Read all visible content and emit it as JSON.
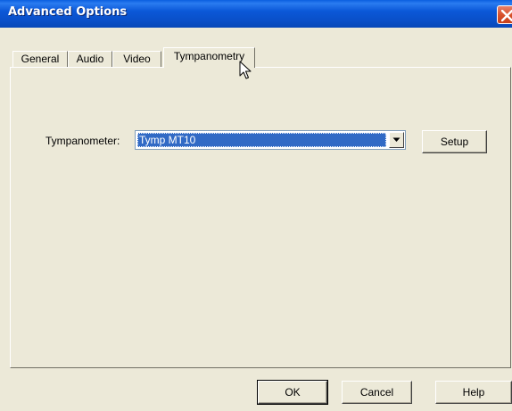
{
  "window": {
    "title": "Advanced Options"
  },
  "tabs": [
    {
      "label": "General",
      "active": false
    },
    {
      "label": "Audio",
      "active": false
    },
    {
      "label": "Video",
      "active": false
    },
    {
      "label": "Tympanometry",
      "active": true
    }
  ],
  "tympanometry": {
    "label": "Tympanometer:",
    "selected": "Tymp MT10",
    "setup_label": "Setup"
  },
  "footer": {
    "ok_label": "OK",
    "cancel_label": "Cancel",
    "help_label": "Help"
  },
  "icons": {
    "close": "close-icon",
    "dropdown": "chevron-down-icon",
    "cursor": "mouse-cursor-icon"
  },
  "colors": {
    "titlebar": "#0a53d0",
    "face": "#ece9d8",
    "selection": "#316ac5",
    "close": "#d8522c"
  }
}
